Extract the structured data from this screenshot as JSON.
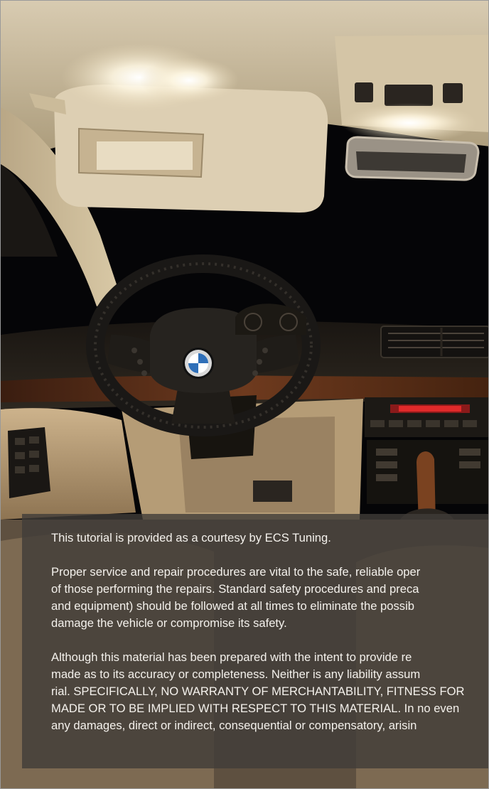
{
  "photo": {
    "subject": "BMW E39 interior at night with LED interior lights",
    "colors": {
      "leather": "#cdb38c",
      "headliner": "#d8cbb1",
      "wood_trim": "#5a2e18",
      "light": "#fffdf2",
      "night": "#050507"
    }
  },
  "disclaimer": {
    "intro": "This tutorial is provided as a courtesy by ECS Tuning.",
    "paragraph_1_lines": [
      "Proper service and repair procedures are vital to the safe, reliable oper",
      "of those performing the repairs. Standard safety procedures and preca",
      "and equipment) should be followed at all times to eliminate the possib",
      "damage the vehicle or compromise its safety."
    ],
    "paragraph_2_lines": [
      "Although this material has been prepared with the intent to provide re",
      "made as to its accuracy or completeness. Neither is any liability assum",
      "rial. SPECIFICALLY, NO WARRANTY OF MERCHANTABILITY, FITNESS FOR",
      "MADE OR TO BE IMPLIED WITH RESPECT TO THIS MATERIAL. In no even",
      "any damages, direct or indirect, consequential or compensatory, arisin"
    ]
  }
}
